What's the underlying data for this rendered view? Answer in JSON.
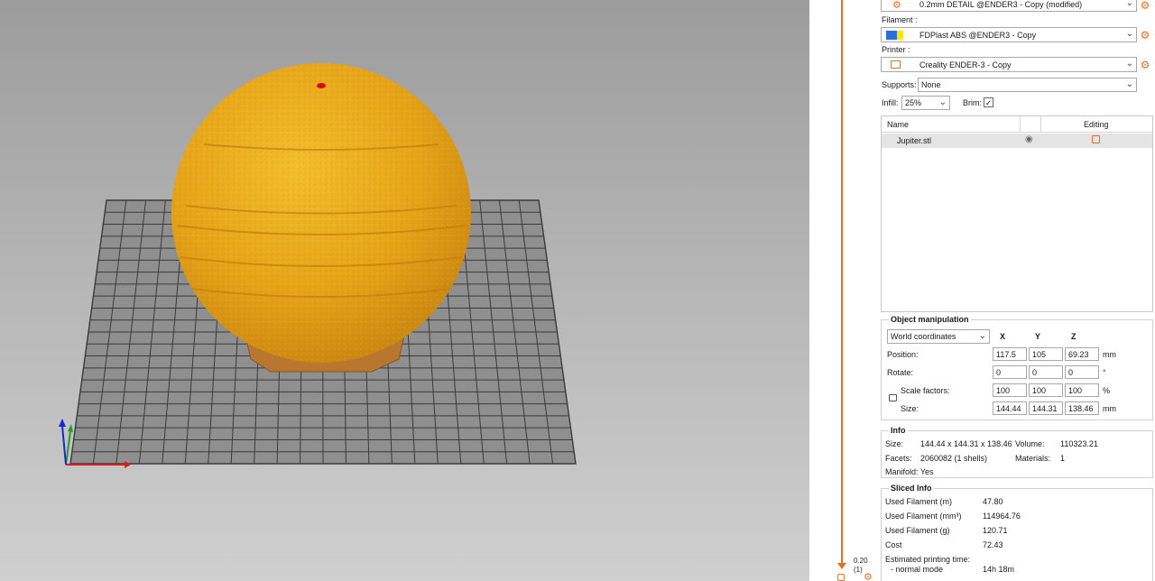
{
  "viewport": {
    "colors": {
      "model": "#e8a417",
      "bed_grid": "#3a3a3a",
      "axis_x": "#d42020",
      "axis_y": "#20a020",
      "axis_z": "#1a2cc8"
    }
  },
  "layer_slider": {
    "value": "0.20",
    "count": "(1)"
  },
  "presets": {
    "print_value": "0.2mm DETAIL @ENDER3 - Copy (modified)",
    "filament_label": "Filament :",
    "filament_value": "FDPlast ABS @ENDER3 - Copy",
    "printer_label": "Printer :",
    "printer_value": "Creality ENDER-3 - Copy"
  },
  "supports": {
    "label": "Supports:",
    "value": "None"
  },
  "infill": {
    "label": "Infill:",
    "value": "25%"
  },
  "brim": {
    "label": "Brim:",
    "checked": true
  },
  "object_list": {
    "col_name": "Name",
    "col_editing": "Editing",
    "rows": [
      {
        "name": "Jupiter.stl"
      }
    ]
  },
  "object_manipulation": {
    "title": "Object manipulation",
    "coord_system": "World coordinates",
    "axis_x": "X",
    "axis_y": "Y",
    "axis_z": "Z",
    "position_label": "Position:",
    "position": [
      "117.5",
      "105",
      "69.23"
    ],
    "position_unit": "mm",
    "rotate_label": "Rotate:",
    "rotate": [
      "0",
      "0",
      "0"
    ],
    "rotate_unit": "°",
    "scale_label": "Scale factors:",
    "scale": [
      "100",
      "100",
      "100"
    ],
    "scale_unit": "%",
    "size_label": "Size:",
    "size": [
      "144.44",
      "144.31",
      "138.46"
    ],
    "size_unit": "mm"
  },
  "info": {
    "title": "Info",
    "size_label": "Size:",
    "size_value": "144.44 x 144.31 x 138.46",
    "volume_label": "Volume:",
    "volume_value": "110323.21",
    "facets_label": "Facets:",
    "facets_value": "2060082 (1 shells)",
    "materials_label": "Materials:",
    "materials_value": "1",
    "manifold": "Manifold: Yes"
  },
  "sliced_info": {
    "title": "Sliced Info",
    "rows": [
      {
        "label": "Used Filament (m)",
        "value": "47.80"
      },
      {
        "label": "Used Filament (mm³)",
        "value": "114964.76"
      },
      {
        "label": "Used Filament (g)",
        "value": "120.71"
      },
      {
        "label": "Cost",
        "value": "72.43"
      }
    ],
    "time_label": "Estimated printing time:",
    "mode_label": "- normal mode",
    "mode_value": "14h 18m"
  }
}
